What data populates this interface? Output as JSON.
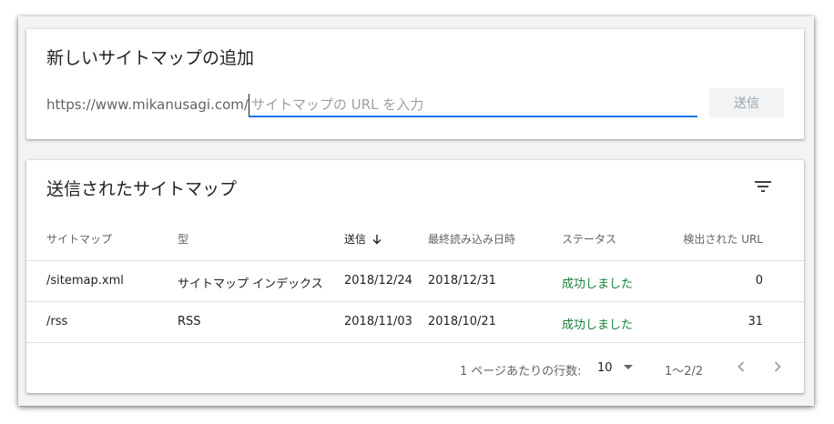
{
  "add_card": {
    "title": "新しいサイトマップの追加",
    "url_prefix": "https://www.mikanusagi.com/",
    "input_placeholder": "サイトマップの URL を入力",
    "input_value": "",
    "submit_label": "送信"
  },
  "list_card": {
    "title": "送信されたサイトマップ",
    "filter_icon": "filter-icon",
    "columns": [
      "サイトマップ",
      "型",
      "送信",
      "最終読み込み日時",
      "ステータス",
      "検出された URL"
    ],
    "sorted_column": "送信",
    "sort_direction": "descending",
    "rows": [
      [
        "/sitemap.xml",
        "サイトマップ インデックス",
        "2018/12/24",
        "2018/12/31",
        "成功しました",
        "0"
      ],
      [
        "/rss",
        "RSS",
        "2018/11/03",
        "2018/10/21",
        "成功しました",
        "31"
      ]
    ],
    "footer": {
      "rows_per_page_label": "1 ページあたりの行数:",
      "rows_per_page_value": "10",
      "range_label": "1〜2/2"
    }
  },
  "colors": {
    "accent": "#1a73e8",
    "success": "#188038",
    "muted_text": "#5f6368"
  }
}
